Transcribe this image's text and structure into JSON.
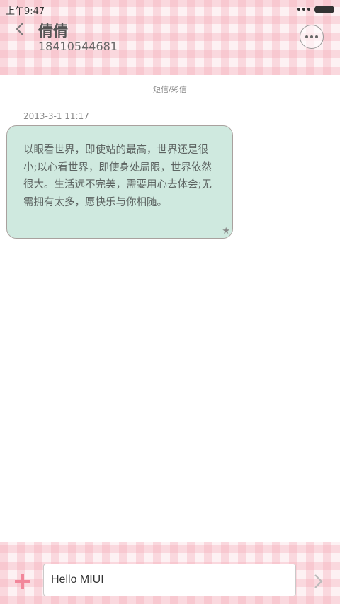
{
  "status_bar": {
    "time": "上午9:47"
  },
  "header": {
    "contact_name": "倩倩",
    "contact_number": "18410544681"
  },
  "conversation": {
    "divider_label": "短信/彩信",
    "timestamp": "2013-3-1 11:17",
    "message_text": "以眼看世界，即使站的最高，世界还是很小;以心看世界，即使身处局限，世界依然很大。生活远不完美，需要用心去体会;无需拥有太多，愿快乐与你相随。",
    "star_glyph": "★"
  },
  "composer": {
    "input_value": "Hello MIUI"
  },
  "colors": {
    "bubble": "#cfe9df",
    "accent_pink": "#f2869a"
  },
  "icons": [
    "back-arrow-icon",
    "more-icon",
    "star-icon",
    "add-icon",
    "send-arrow-icon"
  ]
}
